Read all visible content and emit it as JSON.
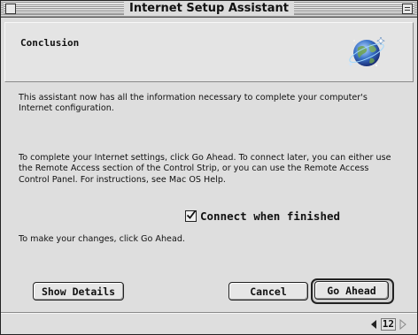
{
  "window": {
    "title": "Internet Setup Assistant"
  },
  "header": {
    "section_title": "Conclusion",
    "icon": "globe-icon"
  },
  "body": {
    "paragraph1": "This assistant now has all the information necessary to complete your computer's Internet configuration.",
    "paragraph2": "To complete your Internet settings, click Go Ahead. To connect later, you can either use the Remote Access section of the Control Strip, or you can use the Remote Access Control Panel. For instructions, see Mac OS Help.",
    "checkbox_label": "Connect when finished",
    "checkbox_checked": true,
    "paragraph3": "To make your changes, click Go Ahead."
  },
  "buttons": {
    "show_details": "Show Details",
    "cancel": "Cancel",
    "go_ahead": "Go Ahead"
  },
  "pager": {
    "page": "12",
    "prev_icon": "triangle-left-icon",
    "next_icon": "triangle-right-icon"
  }
}
